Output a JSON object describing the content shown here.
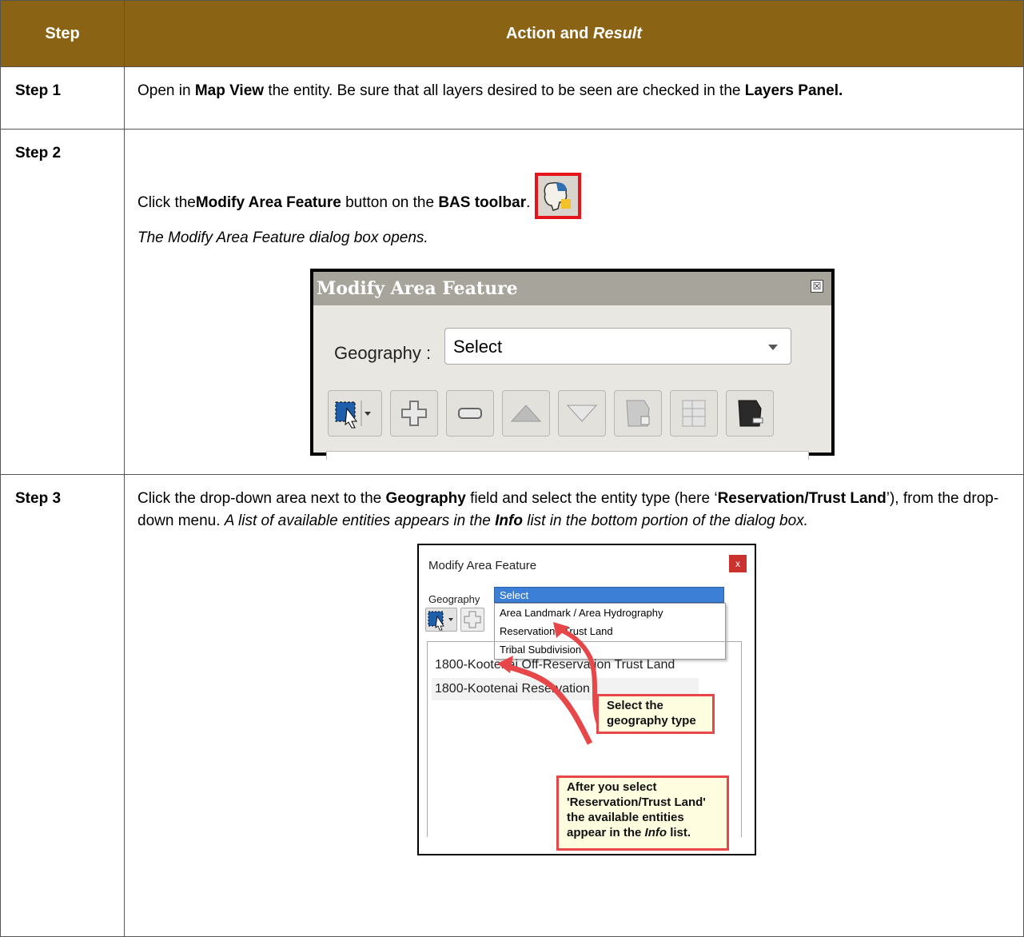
{
  "table": {
    "headers": {
      "step": "Step",
      "action": "Action and ",
      "result": "Result"
    },
    "step1": {
      "label": "Step 1",
      "t1": "Open in ",
      "b1": "Map View",
      "t2": " the entity. Be sure that all layers desired to be seen are checked in the ",
      "b2": "Layers Panel."
    },
    "step2": {
      "label": "Step 2",
      "t1": "Click the ",
      "b1": "Modify Area Feature",
      "t2": " button on the ",
      "b2": "BAS toolbar",
      "t3": ".",
      "result": "The Modify Area Feature dialog box opens."
    },
    "step3": {
      "label": "Step 3",
      "t1": "Click the drop-down area next to the ",
      "b1": "Geography",
      "t2": " field and select the entity type (here ‘",
      "b2": "Reservation/Trust Land",
      "t3": "’), from the drop-down menu. ",
      "r1": "A list of available entities appears in the ",
      "rb": "Info",
      "r2": " list in the bottom portion of the dialog box."
    }
  },
  "dialog1": {
    "title": "Modify Area Feature",
    "close": "☒",
    "geography_label": "Geography :",
    "geography_value": "Select"
  },
  "dialog2": {
    "title": "Modify Area Feature",
    "close": "x",
    "geography_label": "Geography",
    "selected": "Select",
    "options": [
      "Area Landmark / Area Hydrography",
      "Reservation / Trust Land",
      "Tribal Subdivision"
    ],
    "items": [
      "1800-Kootenai Off-Reservation Trust Land",
      "1800-Kootenai Reservation"
    ],
    "callout1": "Select the geography type",
    "callout2_a": "After you select 'Reservation/Trust Land' the available entities appear in the ",
    "callout2_info": "Info",
    "callout2_b": " list."
  },
  "colors": {
    "header_bg": "#8b6314",
    "callout_border": "#e8474a",
    "highlight_border": "#e6141b"
  }
}
